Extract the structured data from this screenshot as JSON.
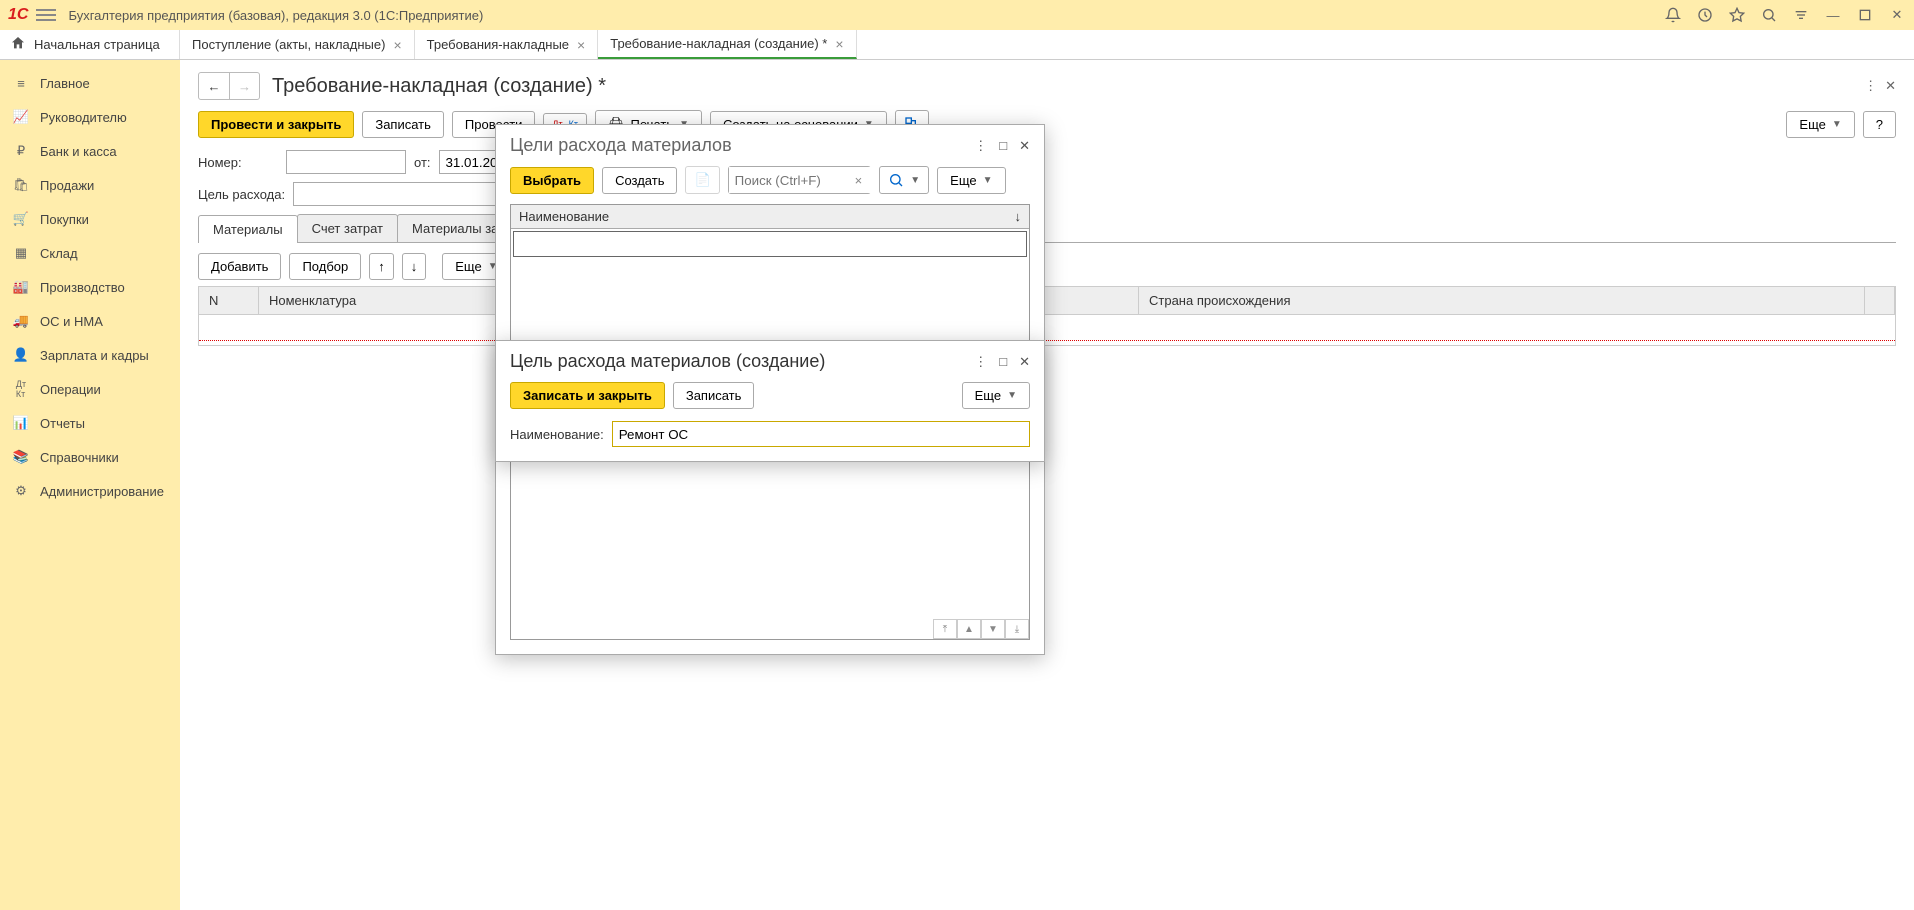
{
  "titlebar": {
    "logo": "1С",
    "title": "Бухгалтерия предприятия (базовая), редакция 3.0  (1С:Предприятие)"
  },
  "tabs": {
    "home": "Начальная страница",
    "items": [
      {
        "label": "Поступление (акты, накладные)",
        "active": false
      },
      {
        "label": "Требования-накладные",
        "active": false
      },
      {
        "label": "Требование-накладная (создание) *",
        "active": true
      }
    ]
  },
  "sidebar": {
    "items": [
      {
        "label": "Главное"
      },
      {
        "label": "Руководителю"
      },
      {
        "label": "Банк и касса"
      },
      {
        "label": "Продажи"
      },
      {
        "label": "Покупки"
      },
      {
        "label": "Склад"
      },
      {
        "label": "Производство"
      },
      {
        "label": "ОС и НМА"
      },
      {
        "label": "Зарплата и кадры"
      },
      {
        "label": "Операции"
      },
      {
        "label": "Отчеты"
      },
      {
        "label": "Справочники"
      },
      {
        "label": "Администрирование"
      }
    ]
  },
  "page": {
    "title": "Требование-накладная (создание) *",
    "toolbar": {
      "post_close": "Провести и закрыть",
      "save": "Записать",
      "post": "Провести",
      "print": "Печать",
      "create_based": "Создать на основании",
      "more": "Еще",
      "help": "?"
    },
    "form": {
      "number_label": "Номер:",
      "number_value": "",
      "from_label": "от:",
      "date_value": "31.01.2020",
      "purpose_label": "Цель расхода:"
    },
    "subtabs": {
      "materials": "Материалы",
      "cost_account": "Счет затрат",
      "customer_materials": "Материалы заказчика"
    },
    "table_toolbar": {
      "add": "Добавить",
      "pick": "Подбор",
      "more": "Еще"
    },
    "table_headers": {
      "n": "N",
      "nomenclature": "Номенклатура",
      "country": "Страна происхождения"
    }
  },
  "dialog1": {
    "title": "Цели расхода материалов",
    "select": "Выбрать",
    "create": "Создать",
    "search_placeholder": "Поиск (Ctrl+F)",
    "more": "Еще",
    "col_name": "Наименование"
  },
  "dialog2": {
    "title": "Цель расхода материалов (создание)",
    "save_close": "Записать и закрыть",
    "save": "Записать",
    "more": "Еще",
    "name_label": "Наименование:",
    "name_value": "Ремонт ОС"
  }
}
